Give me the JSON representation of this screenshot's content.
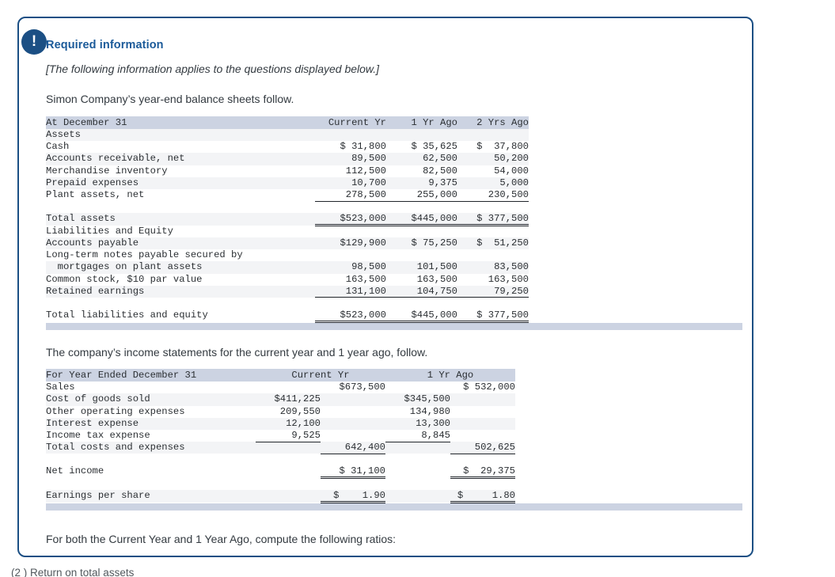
{
  "alert": {
    "icon": "exclamation-icon",
    "glyph": "!",
    "accent_color": "#1b4f84"
  },
  "panel": {
    "title": "Required information",
    "note": "[The following information applies to the questions displayed below.]",
    "intro": "Simon Company’s year-end balance sheets follow.",
    "mid_text": "The company’s income statements for the current year and 1 year ago, follow.",
    "closing_text": "For both the Current Year and 1 Year Ago, compute the following ratios:",
    "cut_off_text": "(2 ) Return on total assets"
  },
  "balance_sheet": {
    "header": {
      "label": "At December 31",
      "col1": "Current Yr",
      "col2": "1 Yr Ago",
      "col3": "2 Yrs Ago"
    },
    "rows": [
      {
        "label": "Assets",
        "bold": true,
        "c1": "",
        "c2": "",
        "c3": ""
      },
      {
        "label": "Cash",
        "c1": "$ 31,800",
        "c2": "$ 35,625",
        "c3": "$  37,800"
      },
      {
        "label": "Accounts receivable, net",
        "c1": "89,500",
        "c2": "62,500",
        "c3": "50,200"
      },
      {
        "label": "Merchandise inventory",
        "c1": "112,500",
        "c2": "82,500",
        "c3": "54,000"
      },
      {
        "label": "Prepaid expenses",
        "c1": "10,700",
        "c2": "9,375",
        "c3": "5,000"
      },
      {
        "label": "Plant assets, net",
        "c1": "278,500",
        "c2": "255,000",
        "c3": "230,500",
        "rule": "single"
      },
      {
        "label": "Total assets",
        "c1": "$523,000",
        "c2": "$445,000",
        "c3": "$ 377,500",
        "rule": "double"
      },
      {
        "label": "Liabilities and Equity",
        "bold": true,
        "c1": "",
        "c2": "",
        "c3": ""
      },
      {
        "label": "Accounts payable",
        "c1": "$129,900",
        "c2": "$ 75,250",
        "c3": "$  51,250"
      },
      {
        "label": "Long-term notes payable secured by",
        "c1": "",
        "c2": "",
        "c3": ""
      },
      {
        "label": "  mortgages on plant assets",
        "c1": "98,500",
        "c2": "101,500",
        "c3": "83,500"
      },
      {
        "label": "Common stock, $10 par value",
        "c1": "163,500",
        "c2": "163,500",
        "c3": "163,500"
      },
      {
        "label": "Retained earnings",
        "c1": "131,100",
        "c2": "104,750",
        "c3": "79,250",
        "rule": "single"
      },
      {
        "label": "Total liabilities and equity",
        "c1": "$523,000",
        "c2": "$445,000",
        "c3": "$ 377,500",
        "rule": "double"
      }
    ]
  },
  "income_statement": {
    "header": {
      "label": "For Year Ended December 31",
      "col_current": "Current Yr",
      "col_prior": "1 Yr Ago"
    },
    "rows": [
      {
        "label": "Sales",
        "a": "",
        "b": "$673,500",
        "c": "",
        "d": "$ 532,000"
      },
      {
        "label": "Cost of goods sold",
        "a": "$411,225",
        "b": "",
        "c": "$345,500",
        "d": ""
      },
      {
        "label": "Other operating expenses",
        "a": "209,550",
        "b": "",
        "c": "134,980",
        "d": ""
      },
      {
        "label": "Interest expense",
        "a": "12,100",
        "b": "",
        "c": "13,300",
        "d": ""
      },
      {
        "label": "Income tax expense",
        "a": "9,525",
        "b": "",
        "c": "8,845",
        "d": "",
        "rule_a": "single",
        "rule_c": "single"
      },
      {
        "label": "Total costs and expenses",
        "a": "",
        "b": "642,400",
        "c": "",
        "d": "502,625",
        "rule_b": "single",
        "rule_d": "single"
      },
      {
        "label": "Net income",
        "a": "",
        "b": "$ 31,100",
        "c": "",
        "d": "$  29,375",
        "rule_b": "double",
        "rule_d": "double"
      },
      {
        "label": "Earnings per share",
        "a": "",
        "b": "$    1.90",
        "c": "",
        "d": "$     1.80",
        "rule_b": "double",
        "rule_d": "double"
      }
    ]
  },
  "colors": {
    "header_bg": "#ccd3e2",
    "alt_row_bg": "#f3f4f6",
    "title_blue": "#1b5a99",
    "border_navy": "#1b4f84"
  }
}
